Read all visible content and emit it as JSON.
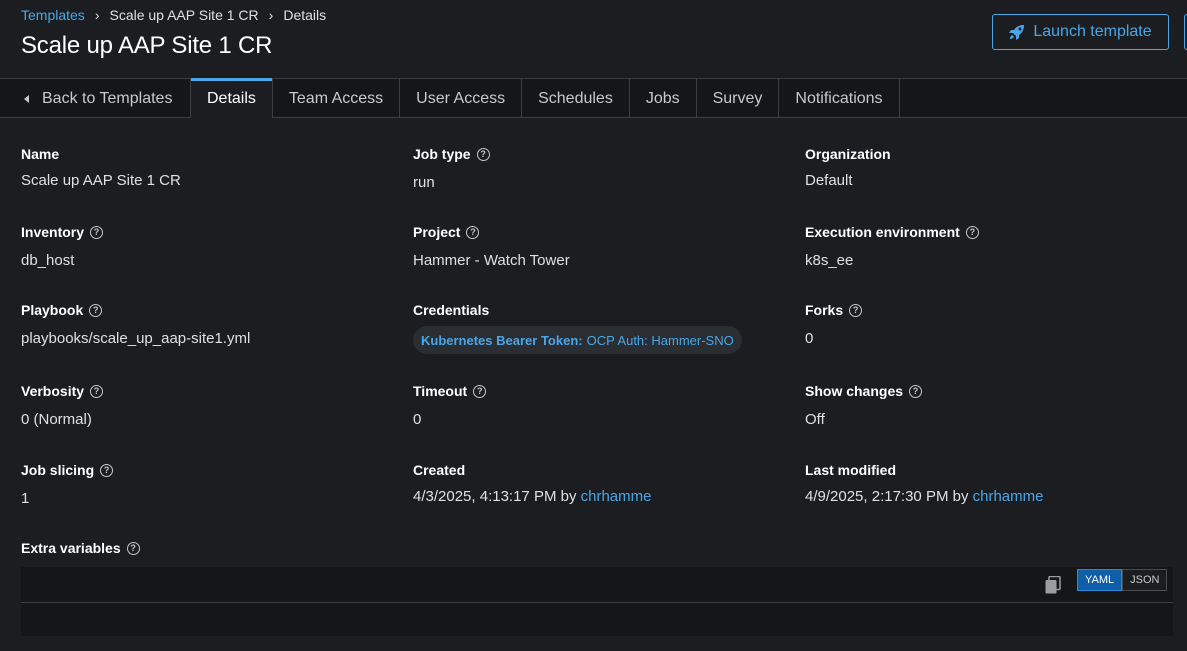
{
  "breadcrumb": {
    "items": [
      "Templates",
      "Scale up AAP Site 1 CR",
      "Details"
    ]
  },
  "header": {
    "title": "Scale up AAP Site 1 CR",
    "launch_label": "Launch template"
  },
  "tabs": {
    "back": "Back to Templates",
    "items": [
      "Details",
      "Team Access",
      "User Access",
      "Schedules",
      "Jobs",
      "Survey",
      "Notifications"
    ],
    "active": "Details"
  },
  "details": {
    "name": {
      "label": "Name",
      "value": "Scale up AAP Site 1 CR"
    },
    "job_type": {
      "label": "Job type",
      "value": "run"
    },
    "organization": {
      "label": "Organization",
      "value": "Default"
    },
    "inventory": {
      "label": "Inventory",
      "value": "db_host"
    },
    "project": {
      "label": "Project",
      "value": "Hammer - Watch Tower"
    },
    "execution_environment": {
      "label": "Execution environment",
      "value": "k8s_ee"
    },
    "playbook": {
      "label": "Playbook",
      "value": "playbooks/scale_up_aap-site1.yml"
    },
    "credentials": {
      "label": "Credentials",
      "chip_type": "Kubernetes Bearer Token:",
      "chip_name": "OCP Auth: Hammer-SNO"
    },
    "forks": {
      "label": "Forks",
      "value": "0"
    },
    "verbosity": {
      "label": "Verbosity",
      "value": "0 (Normal)"
    },
    "timeout": {
      "label": "Timeout",
      "value": "0"
    },
    "show_changes": {
      "label": "Show changes",
      "value": "Off"
    },
    "job_slicing": {
      "label": "Job slicing",
      "value": "1"
    },
    "created": {
      "label": "Created",
      "value": "4/3/2025, 4:13:17 PM by",
      "user": "chrhamme"
    },
    "last_modified": {
      "label": "Last modified",
      "value": "4/9/2025, 2:17:30 PM by",
      "user": "chrhamme"
    },
    "extra_variables": {
      "label": "Extra variables"
    }
  },
  "editor": {
    "modes": [
      "YAML",
      "JSON"
    ],
    "active_mode": "YAML"
  },
  "colors": {
    "background": "#1b1d21",
    "accent": "#4aa6e8",
    "tab_bar": "#151618"
  },
  "icons": [
    "angle-right-icon",
    "rocket-icon",
    "caret-left-icon",
    "help-icon",
    "copy-icon"
  ]
}
